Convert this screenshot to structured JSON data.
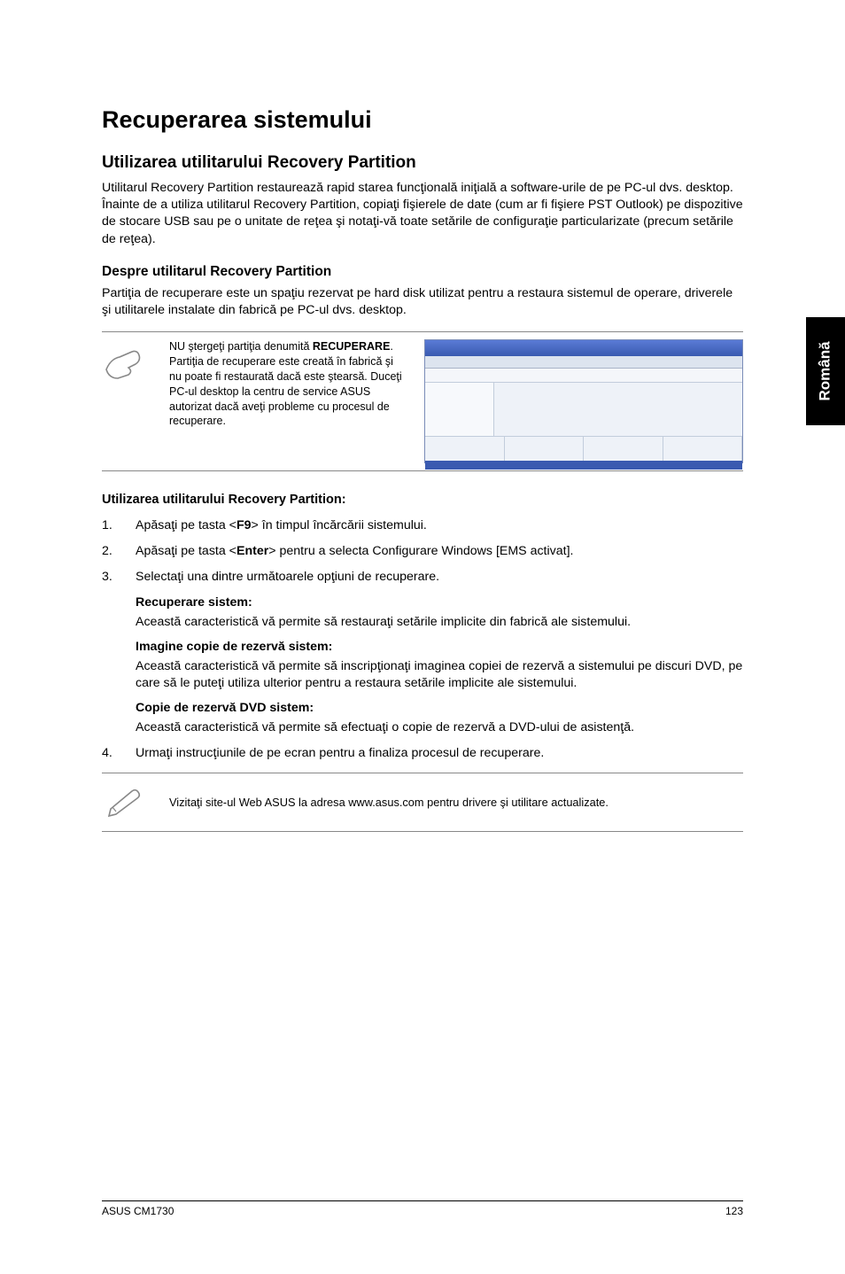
{
  "title": "Recuperarea sistemului",
  "section1": {
    "heading": "Utilizarea utilitarului Recovery Partition",
    "intro": "Utilitarul Recovery Partition restaurează rapid starea funcţională iniţială a software-urile de pe PC-ul dvs. desktop. Înainte de a utiliza utilitarul Recovery Partition, copiaţi fişierele de date (cum ar fi fişiere PST Outlook) pe dispozitive de stocare USB sau pe o unitate de reţea şi notaţi-vă toate setările de configuraţie particularizate (precum setările de reţea).",
    "sub_heading": "Despre utilitarul Recovery Partition",
    "sub_text": "Partiţia de recuperare este un spaţiu rezervat pe hard disk utilizat pentru a restaura sistemul de operare, driverele şi utilitarele instalate din fabrică pe PC-ul dvs. desktop."
  },
  "note1": {
    "prefix": "NU ştergeţi partiţia denumită ",
    "bold": "RECUPERARE",
    "rest": ". Partiţia de recuperare este creată în fabrică şi nu poate fi restaurată dacă este ştearsă. Duceţi PC-ul desktop la centru de service ASUS autorizat dacă aveţi probleme cu procesul de recuperare."
  },
  "usage_heading": "Utilizarea utilitarului Recovery Partition:",
  "steps": [
    {
      "num": "1.",
      "pre": "Apăsaţi pe tasta <",
      "key": "F9",
      "post": "> în timpul încărcării sistemului."
    },
    {
      "num": "2.",
      "pre": "Apăsaţi pe tasta <",
      "key": "Enter",
      "post": "> pentru a selecta Configurare Windows [EMS activat]."
    },
    {
      "num": "3.",
      "text": "Selectaţi una dintre următoarele opţiuni de recuperare."
    }
  ],
  "options": [
    {
      "label": "Recuperare sistem:",
      "desc": "Această caracteristică vă permite să restauraţi setările implicite din fabrică ale sistemului."
    },
    {
      "label": "Imagine copie de rezervă sistem:",
      "desc": "Această caracteristică vă permite să inscripţionaţi imaginea copiei de rezervă a sistemului pe discuri DVD, pe care să le puteţi utiliza ulterior pentru a restaura setările implicite ale sistemului."
    },
    {
      "label": "Copie de rezervă DVD sistem:",
      "desc": "Această caracteristică vă permite să efectuaţi o copie de rezervă a DVD-ului de asistenţă."
    }
  ],
  "step4": {
    "num": "4.",
    "text": "Urmaţi instrucţiunile de pe ecran pentru a finaliza procesul de recuperare."
  },
  "note2": "Vizitaţi site-ul Web ASUS la adresa www.asus.com pentru drivere şi utilitare actualizate.",
  "side_tab": "Română",
  "footer_left": "ASUS CM1730",
  "footer_right": "123"
}
